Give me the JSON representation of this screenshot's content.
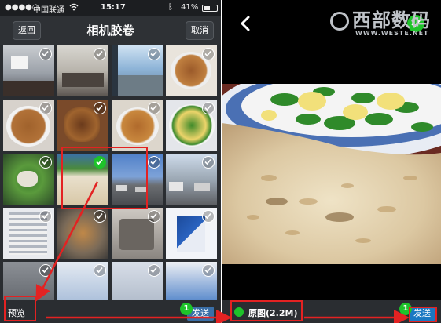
{
  "status": {
    "carrier": "中国联通",
    "time": "15:17",
    "battery": "41%"
  },
  "nav": {
    "back_label": "返回",
    "title": "相机胶卷",
    "cancel_label": "取消"
  },
  "bottom": {
    "preview_label": "预览",
    "send_label": "发送",
    "selected_count": "1",
    "original_label": "原图(2.2M)"
  },
  "watermark": {
    "brand": "西部数码",
    "url": "WWW.WESTE.NET"
  },
  "photos": [
    {
      "alt": "meeting-room",
      "selected": false
    },
    {
      "alt": "presentation",
      "selected": false
    },
    {
      "alt": "window-view",
      "selected": false
    },
    {
      "alt": "food-plate",
      "selected": false
    },
    {
      "alt": "food-plate",
      "selected": false
    },
    {
      "alt": "food-plate",
      "selected": false
    },
    {
      "alt": "food-plate",
      "selected": false
    },
    {
      "alt": "food-plate",
      "selected": false
    },
    {
      "alt": "vegetables",
      "selected": false
    },
    {
      "alt": "pancake-plate",
      "selected": true
    },
    {
      "alt": "parking-lot",
      "selected": false
    },
    {
      "alt": "parking-lot",
      "selected": false
    },
    {
      "alt": "document",
      "selected": false
    },
    {
      "alt": "food-tray",
      "selected": false
    },
    {
      "alt": "tray",
      "selected": false
    },
    {
      "alt": "maxsun-logo",
      "selected": false
    },
    {
      "alt": "machine",
      "selected": false
    },
    {
      "alt": "poster",
      "selected": false
    },
    {
      "alt": "sign",
      "selected": false
    },
    {
      "alt": "poster",
      "selected": false
    }
  ],
  "colors": {
    "accent_green": "#1ec32a",
    "send_blue": "#1a78c2",
    "annotation_red": "#e32222"
  }
}
